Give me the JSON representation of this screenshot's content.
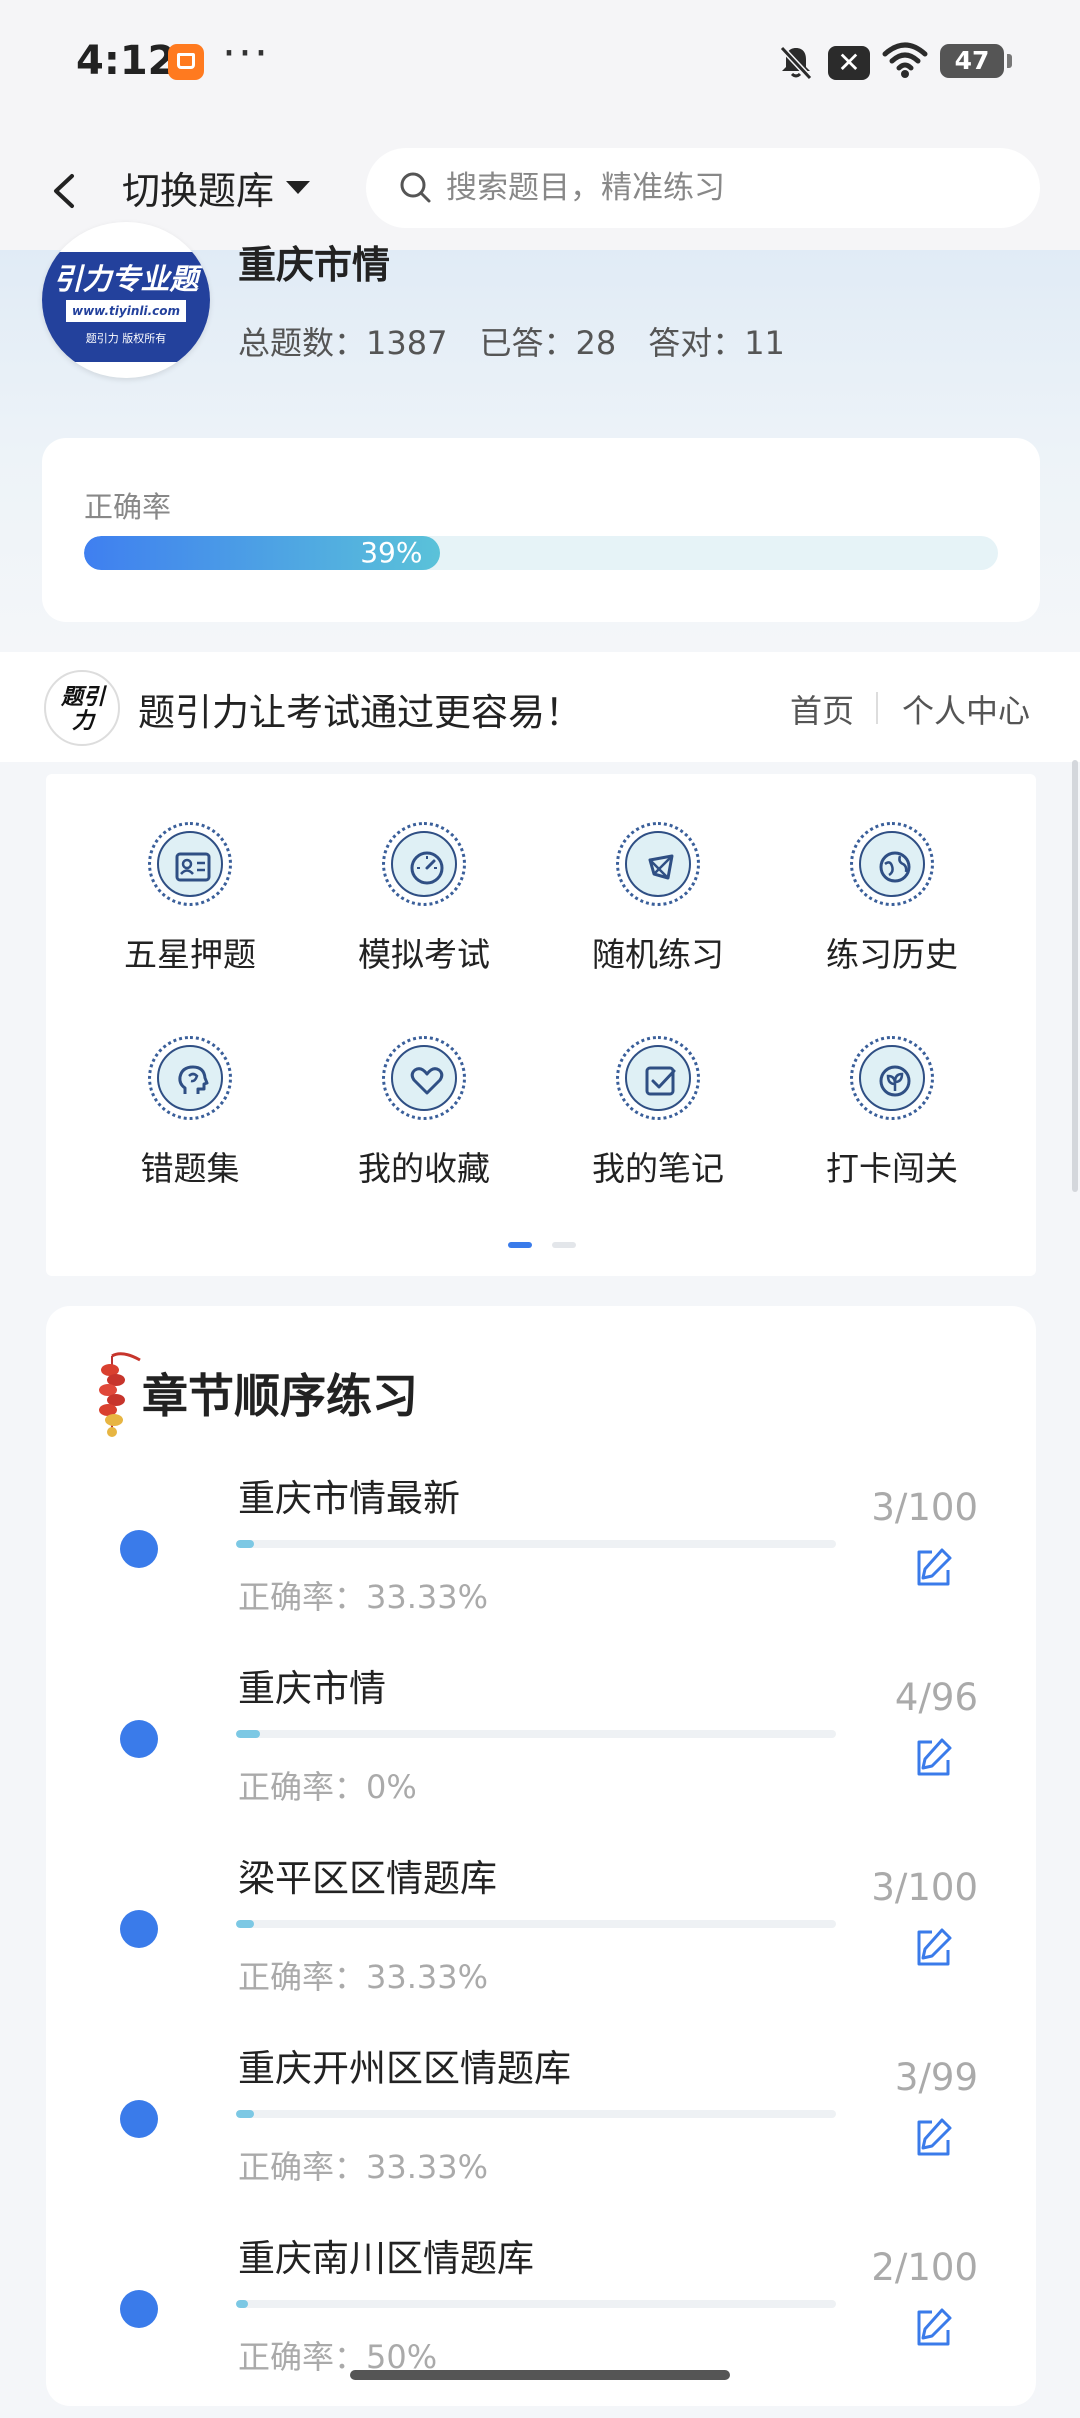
{
  "status": {
    "time": "4:12",
    "more": "···",
    "close_badge": "✕",
    "battery": "47"
  },
  "header": {
    "switch_label": "切换题库",
    "search_placeholder": "搜索题目，精准练习"
  },
  "logo": {
    "band_text": "引力专业题",
    "url": "www.tiyinli.com",
    "copyright": "题引力 版权所有"
  },
  "profile": {
    "title": "重庆市情",
    "total": "总题数：1387",
    "answered": "已答：28",
    "correct": "答对：11"
  },
  "accuracy": {
    "label": "正确率",
    "percent_text": "39%",
    "value": 0.39
  },
  "promo": {
    "logo_text": "题引力",
    "text": "题引力让考试通过更容易！",
    "home": "首页",
    "center": "个人中心"
  },
  "features": [
    {
      "label": "五星押题",
      "icon": "id-card-icon"
    },
    {
      "label": "模拟考试",
      "icon": "speedometer-icon"
    },
    {
      "label": "随机练习",
      "icon": "network-icon"
    },
    {
      "label": "练习历史",
      "icon": "globe-icon"
    },
    {
      "label": "错题集",
      "icon": "head-icon"
    },
    {
      "label": "我的收藏",
      "icon": "heart-icon"
    },
    {
      "label": "我的笔记",
      "icon": "check-note-icon"
    },
    {
      "label": "打卡闯关",
      "icon": "leaf-badge-icon"
    }
  ],
  "chapters": {
    "title": "章节顺序练习",
    "items": [
      {
        "name": "重庆市情最新",
        "rate": "正确率：33.33%",
        "count": "3/100",
        "progress": 0.03
      },
      {
        "name": "重庆市情",
        "rate": "正确率：0%",
        "count": "4/96",
        "progress": 0.04
      },
      {
        "name": "梁平区区情题库",
        "rate": "正确率：33.33%",
        "count": "3/100",
        "progress": 0.03
      },
      {
        "name": "重庆开州区区情题库",
        "rate": "正确率：33.33%",
        "count": "3/99",
        "progress": 0.03
      },
      {
        "name": "重庆南川区情题库",
        "rate": "正确率：50%",
        "count": "2/100",
        "progress": 0.02
      }
    ]
  },
  "colors": {
    "accent": "#3a7bea",
    "progress_light": "#7cc8e4",
    "logo_blue": "#23419c"
  }
}
